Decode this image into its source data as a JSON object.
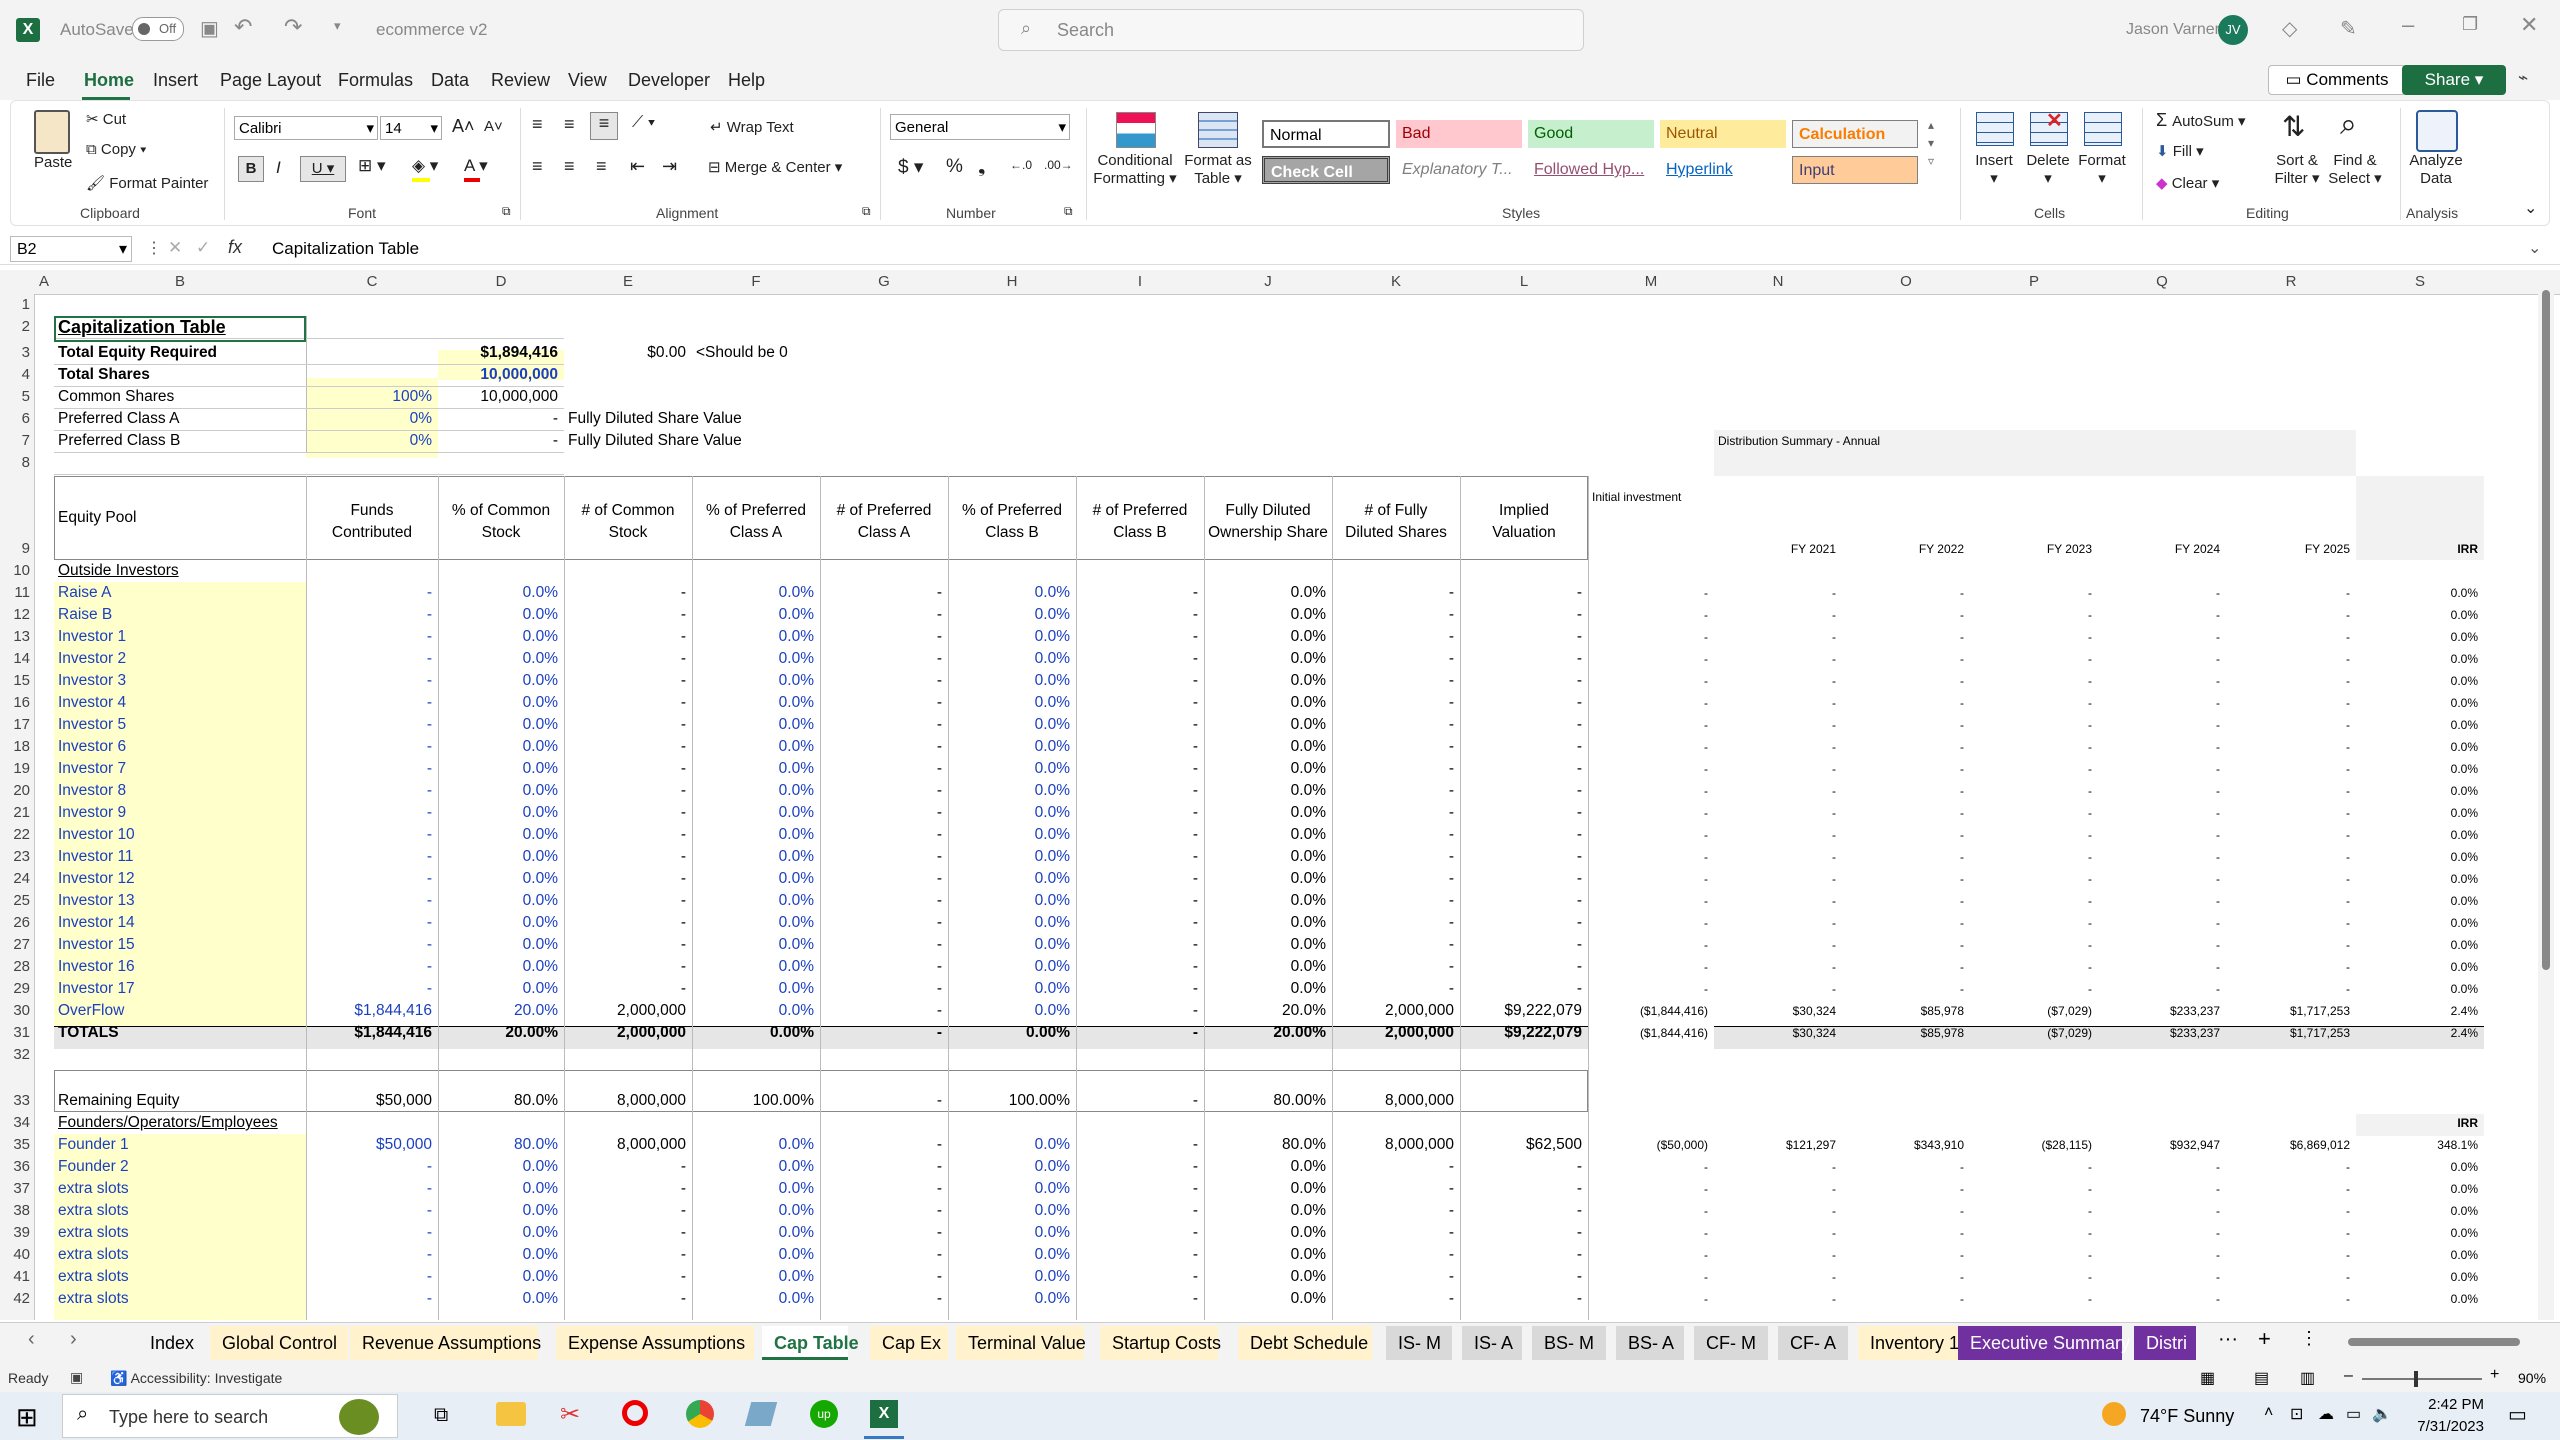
{
  "titlebar": {
    "autosave": "AutoSave",
    "autosave_state": "Off",
    "filename": "ecommerce v2",
    "search_placeholder": "Search",
    "user_name": "Jason Varner",
    "user_initials": "JV"
  },
  "menu": [
    "File",
    "Home",
    "Insert",
    "Page Layout",
    "Formulas",
    "Data",
    "Review",
    "View",
    "Developer",
    "Help"
  ],
  "menu_right": {
    "comments": "Comments",
    "share": "Share"
  },
  "ribbon": {
    "paste": "Paste",
    "cut": "Cut",
    "copy": "Copy",
    "format_painter": "Format Painter",
    "clipboard": "Clipboard",
    "font_name": "Calibri",
    "font_size": "14",
    "font": "Font",
    "wrap_text": "Wrap Text",
    "merge_center": "Merge & Center",
    "alignment": "Alignment",
    "number_format": "General",
    "number": "Number",
    "conditional": "Conditional",
    "formatting": "Formatting",
    "format_as": "Format as",
    "table": "Table",
    "styles": {
      "normal": "Normal",
      "bad": "Bad",
      "good": "Good",
      "neutral": "Neutral",
      "calculation": "Calculation",
      "check_cell": "Check Cell",
      "explanatory": "Explanatory T...",
      "followed": "Followed Hyp...",
      "hyperlink": "Hyperlink",
      "input": "Input"
    },
    "styles_label": "Styles",
    "insert": "Insert",
    "delete": "Delete",
    "format": "Format",
    "cells": "Cells",
    "autosum": "AutoSum",
    "fill": "Fill",
    "clear": "Clear",
    "sort_filter": "Sort &",
    "filter": "Filter",
    "find_select": "Find &",
    "select": "Select",
    "editing": "Editing",
    "analyze": "Analyze",
    "data": "Data",
    "analysis": "Analysis"
  },
  "formula_bar": {
    "name_box": "B2",
    "fx": "fx",
    "formula": "Capitalization Table"
  },
  "columns": [
    "A",
    "B",
    "C",
    "D",
    "E",
    "F",
    "G",
    "H",
    "I",
    "J",
    "K",
    "L",
    "M",
    "N",
    "O",
    "P",
    "Q",
    "R",
    "S"
  ],
  "sheet": {
    "title": "Capitalization Table",
    "r3": {
      "label": "Total Equity Required",
      "d": "$1,894,416",
      "e": "$0.00",
      "f": "<Should be 0"
    },
    "r4": {
      "label": "Total Shares",
      "d": "10,000,000"
    },
    "r5": {
      "label": "Common Shares",
      "c": "100%",
      "d": "10,000,000"
    },
    "r6": {
      "label": "Preferred Class A",
      "c": "0%",
      "d": "-",
      "e": "Fully Diluted Share Value"
    },
    "r7": {
      "label": "Preferred Class B",
      "c": "0%",
      "d": "-",
      "e": "Fully Diluted Share Value"
    },
    "dist_summary": "Distribution Summary - Annual",
    "headers": {
      "b": "Equity Pool",
      "c": [
        "Funds",
        "Contributed"
      ],
      "d": [
        "% of Common",
        "Stock"
      ],
      "e": [
        "# of Common",
        "Stock"
      ],
      "f": [
        "% of Preferred",
        "Class A"
      ],
      "g": [
        "# of Preferred",
        "Class A"
      ],
      "h": [
        "% of Preferred",
        "Class B"
      ],
      "i": [
        "# of Preferred",
        "Class B"
      ],
      "j": [
        "Fully Diluted",
        "Ownership Share"
      ],
      "k": [
        "# of Fully",
        "Diluted Shares"
      ],
      "l": [
        "Implied",
        "Valuation"
      ],
      "m": "Initial investment",
      "n": "FY 2021",
      "o": "FY 2022",
      "p": "FY 2023",
      "q": "FY 2024",
      "r": "FY 2025",
      "s": "IRR"
    },
    "outside_investors": "Outside Investors",
    "investor_names": [
      "Raise A",
      "Raise B",
      "Investor 1",
      "Investor 2",
      "Investor 3",
      "Investor 4",
      "Investor 5",
      "Investor 6",
      "Investor 7",
      "Investor 8",
      "Investor 9",
      "Investor 10",
      "Investor 11",
      "Investor 12",
      "Investor 13",
      "Investor 14",
      "Investor 15",
      "Investor 16",
      "Investor 17"
    ],
    "overflow": {
      "b": "OverFlow",
      "c": "$1,844,416",
      "d": "20.0%",
      "e": "2,000,000",
      "f": "0.0%",
      "g": "-",
      "h": "0.0%",
      "i": "-",
      "j": "20.0%",
      "k": "2,000,000",
      "l": "$9,222,079",
      "m": "($1,844,416)",
      "n": "$30,324",
      "o": "$85,978",
      "p": "($7,029)",
      "q": "$233,237",
      "r": "$1,717,253",
      "s": "2.4%"
    },
    "totals": {
      "b": "TOTALS",
      "c": "$1,844,416",
      "d": "20.00%",
      "e": "2,000,000",
      "f": "0.00%",
      "g": "-",
      "h": "0.00%",
      "i": "-",
      "j": "20.00%",
      "k": "2,000,000",
      "l": "$9,222,079",
      "m": "($1,844,416)",
      "n": "$30,324",
      "o": "$85,978",
      "p": "($7,029)",
      "q": "$233,237",
      "r": "$1,717,253",
      "s": "2.4%"
    },
    "remaining": {
      "b": "Remaining Equity",
      "c": "$50,000",
      "d": "80.0%",
      "e": "8,000,000",
      "f": "100.00%",
      "g": "-",
      "h": "100.00%",
      "i": "-",
      "j": "80.00%",
      "k": "8,000,000"
    },
    "founders_label": "Founders/Operators/Employees",
    "irr_label": "IRR",
    "founder1": {
      "b": "Founder 1",
      "c": "$50,000",
      "d": "80.0%",
      "e": "8,000,000",
      "f": "0.0%",
      "g": "-",
      "h": "0.0%",
      "i": "-",
      "j": "80.0%",
      "k": "8,000,000",
      "l": "$62,500",
      "m": "($50,000)",
      "n": "$121,297",
      "o": "$343,910",
      "p": "($28,115)",
      "q": "$932,947",
      "r": "$6,869,012",
      "s": "348.1%"
    },
    "founder_names": [
      "Founder 2",
      "extra slots",
      "extra slots",
      "extra slots",
      "extra slots",
      "extra slots",
      "extra slots"
    ],
    "dash": "-",
    "zero_pct": "0.0%"
  },
  "sheet_tabs": [
    "Index",
    "Global Control",
    "Revenue Assumptions",
    "Expense Assumptions",
    "Cap Table",
    "Cap Ex",
    "Terminal Value",
    "Startup Costs",
    "Debt Schedule",
    "IS- M",
    "IS- A",
    "BS- M",
    "BS- A",
    "CF- M",
    "CF- A",
    "Inventory 1",
    "Executive Summary",
    "Distri"
  ],
  "status": {
    "ready": "Ready",
    "accessibility": "Accessibility: Investigate",
    "zoom": "90%"
  },
  "taskbar": {
    "search_placeholder": "Type here to search",
    "weather": "74°F  Sunny",
    "time": "2:42 PM",
    "date": "7/31/2023"
  }
}
